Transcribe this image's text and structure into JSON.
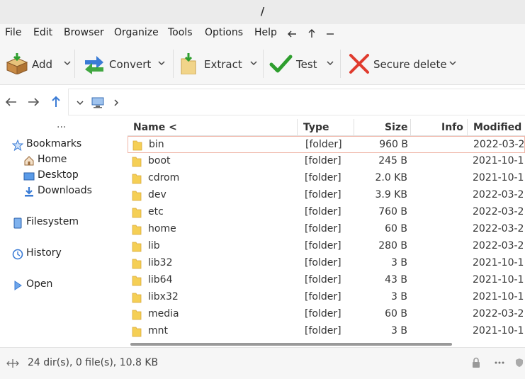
{
  "window": {
    "title": "/"
  },
  "menu": [
    "File",
    "Edit",
    "Browser",
    "Organize",
    "Tools",
    "Options",
    "Help"
  ],
  "toolbar": {
    "add": "Add",
    "convert": "Convert",
    "extract": "Extract",
    "test": "Test",
    "secure_delete": "Secure delete"
  },
  "sidebar": {
    "dots": "···",
    "bookmarks": "Bookmarks",
    "home": "Home",
    "desktop": "Desktop",
    "downloads": "Downloads",
    "filesystem": "Filesystem",
    "history": "History",
    "open": "Open"
  },
  "columns": {
    "name": "Name <",
    "type": "Type",
    "size": "Size",
    "info": "Info",
    "modified": "Modified"
  },
  "rows": [
    {
      "name": "bin",
      "type": "[folder]",
      "size": "960 B",
      "modified": "2022-03-2"
    },
    {
      "name": "boot",
      "type": "[folder]",
      "size": "245 B",
      "modified": "2021-10-1"
    },
    {
      "name": "cdrom",
      "type": "[folder]",
      "size": "2.0 KB",
      "modified": "2021-10-1"
    },
    {
      "name": "dev",
      "type": "[folder]",
      "size": "3.9 KB",
      "modified": "2022-03-2"
    },
    {
      "name": "etc",
      "type": "[folder]",
      "size": "760 B",
      "modified": "2022-03-2"
    },
    {
      "name": "home",
      "type": "[folder]",
      "size": "60 B",
      "modified": "2022-03-2"
    },
    {
      "name": "lib",
      "type": "[folder]",
      "size": "280 B",
      "modified": "2022-03-2"
    },
    {
      "name": "lib32",
      "type": "[folder]",
      "size": "3 B",
      "modified": "2021-10-1"
    },
    {
      "name": "lib64",
      "type": "[folder]",
      "size": "43 B",
      "modified": "2021-10-1"
    },
    {
      "name": "libx32",
      "type": "[folder]",
      "size": "3 B",
      "modified": "2021-10-1"
    },
    {
      "name": "media",
      "type": "[folder]",
      "size": "60 B",
      "modified": "2022-03-2"
    },
    {
      "name": "mnt",
      "type": "[folder]",
      "size": "3 B",
      "modified": "2021-10-1"
    }
  ],
  "status": {
    "summary": "24 dir(s), 0 file(s), 10.8 KB"
  },
  "colors": {
    "folder": "#f5cf55",
    "accent": "#3a7bd5",
    "test_green": "#2e9e2e",
    "delete_red": "#e03b2e",
    "selection_border": "#f0b6a8"
  }
}
